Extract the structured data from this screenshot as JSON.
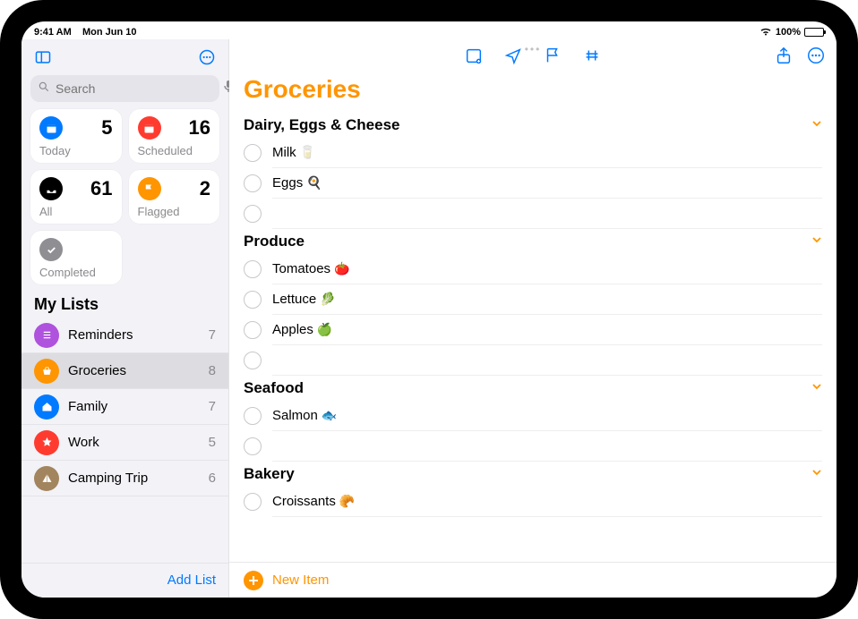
{
  "status": {
    "time": "9:41 AM",
    "date": "Mon Jun 10",
    "battery": "100%"
  },
  "search": {
    "placeholder": "Search"
  },
  "smart": {
    "today": {
      "label": "Today",
      "count": "5",
      "color": "#007aff"
    },
    "scheduled": {
      "label": "Scheduled",
      "count": "16",
      "color": "#ff3b30"
    },
    "all": {
      "label": "All",
      "count": "61",
      "color": "#000000"
    },
    "flagged": {
      "label": "Flagged",
      "count": "2",
      "color": "#ff9500"
    },
    "completed": {
      "label": "Completed",
      "count": "",
      "color": "#8e8e93"
    }
  },
  "mylists_header": "My Lists",
  "lists": [
    {
      "name": "Reminders",
      "count": "7",
      "color": "#af52de",
      "icon": "list"
    },
    {
      "name": "Groceries",
      "count": "8",
      "color": "#ff9500",
      "icon": "basket",
      "selected": true
    },
    {
      "name": "Family",
      "count": "7",
      "color": "#007aff",
      "icon": "house"
    },
    {
      "name": "Work",
      "count": "5",
      "color": "#ff3b30",
      "icon": "star"
    },
    {
      "name": "Camping Trip",
      "count": "6",
      "color": "#a2845e",
      "icon": "tent"
    }
  ],
  "add_list_label": "Add List",
  "current_list": {
    "title": "Groceries",
    "accent": "#ff9500",
    "sections": [
      {
        "name": "Dairy, Eggs & Cheese",
        "items": [
          {
            "text": "Milk",
            "emoji": "🥛"
          },
          {
            "text": "Eggs",
            "emoji": "🍳"
          },
          {
            "text": "",
            "emoji": ""
          }
        ]
      },
      {
        "name": "Produce",
        "items": [
          {
            "text": "Tomatoes",
            "emoji": "🍅"
          },
          {
            "text": "Lettuce",
            "emoji": "🥬"
          },
          {
            "text": "Apples",
            "emoji": "🍏"
          },
          {
            "text": "",
            "emoji": ""
          }
        ]
      },
      {
        "name": "Seafood",
        "items": [
          {
            "text": "Salmon",
            "emoji": "🐟"
          },
          {
            "text": "",
            "emoji": ""
          }
        ]
      },
      {
        "name": "Bakery",
        "items": [
          {
            "text": "Croissants",
            "emoji": "🥐"
          }
        ]
      }
    ],
    "new_item_label": "New Item"
  }
}
